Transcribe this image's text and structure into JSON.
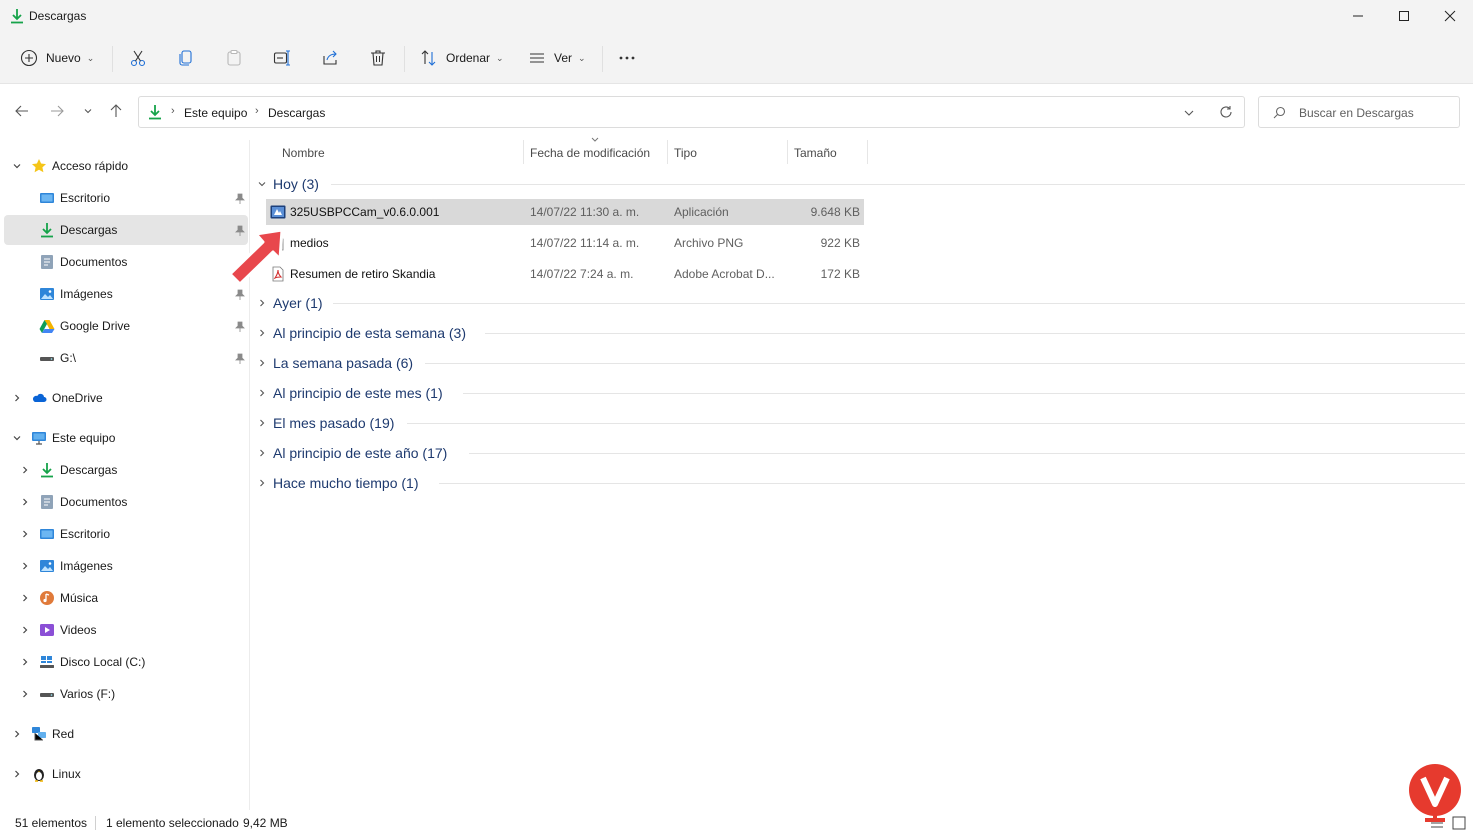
{
  "window": {
    "title": "Descargas"
  },
  "toolbar": {
    "new_label": "Nuevo",
    "sort_label": "Ordenar",
    "view_label": "Ver"
  },
  "address": {
    "crumbs": [
      "Este equipo",
      "Descargas"
    ],
    "search_placeholder": "Buscar en Descargas"
  },
  "sidebar": {
    "quick_access": "Acceso rápido",
    "quick_items": [
      {
        "label": "Escritorio"
      },
      {
        "label": "Descargas"
      },
      {
        "label": "Documentos"
      },
      {
        "label": "Imágenes"
      },
      {
        "label": "Google Drive"
      },
      {
        "label": "G:\\"
      }
    ],
    "onedrive": "OneDrive",
    "this_pc": "Este equipo",
    "pc_items": [
      {
        "label": "Descargas"
      },
      {
        "label": "Documentos"
      },
      {
        "label": "Escritorio"
      },
      {
        "label": "Imágenes"
      },
      {
        "label": "Música"
      },
      {
        "label": "Videos"
      },
      {
        "label": "Disco Local (C:)"
      },
      {
        "label": "Varios (F:)"
      }
    ],
    "network": "Red",
    "linux": "Linux"
  },
  "columns": {
    "name": "Nombre",
    "date": "Fecha de modificación",
    "type": "Tipo",
    "size": "Tamaño"
  },
  "groups": {
    "today": "Hoy (3)",
    "collapsed": [
      "Ayer (1)",
      "Al principio de esta semana (3)",
      "La semana pasada (6)",
      "Al principio de este mes (1)",
      "El mes pasado (19)",
      "Al principio de este año (17)",
      "Hace mucho tiempo (1)"
    ]
  },
  "files": [
    {
      "name": "325USBPCCam_v0.6.0.001",
      "date": "14/07/22 11:30 a. m.",
      "type": "Aplicación",
      "size": "9.648 KB",
      "icon": "application-icon",
      "selected": true
    },
    {
      "name": "medios",
      "date": "14/07/22 11:14 a. m.",
      "type": "Archivo PNG",
      "size": "922 KB",
      "icon": "png-file-icon",
      "selected": false
    },
    {
      "name": "Resumen de retiro Skandia",
      "date": "14/07/22 7:24 a. m.",
      "type": "Adobe Acrobat D...",
      "size": "172 KB",
      "icon": "pdf-file-icon",
      "selected": false
    }
  ],
  "status": {
    "count": "51 elementos",
    "selection": "1 elemento seleccionado",
    "selection_size": "9,42 MB"
  },
  "colors": {
    "accent_green": "#16a34a",
    "group_header_text": "#1e3a6f",
    "arrow_red": "#e8474c",
    "selection_bg": "#d9d9d9"
  }
}
